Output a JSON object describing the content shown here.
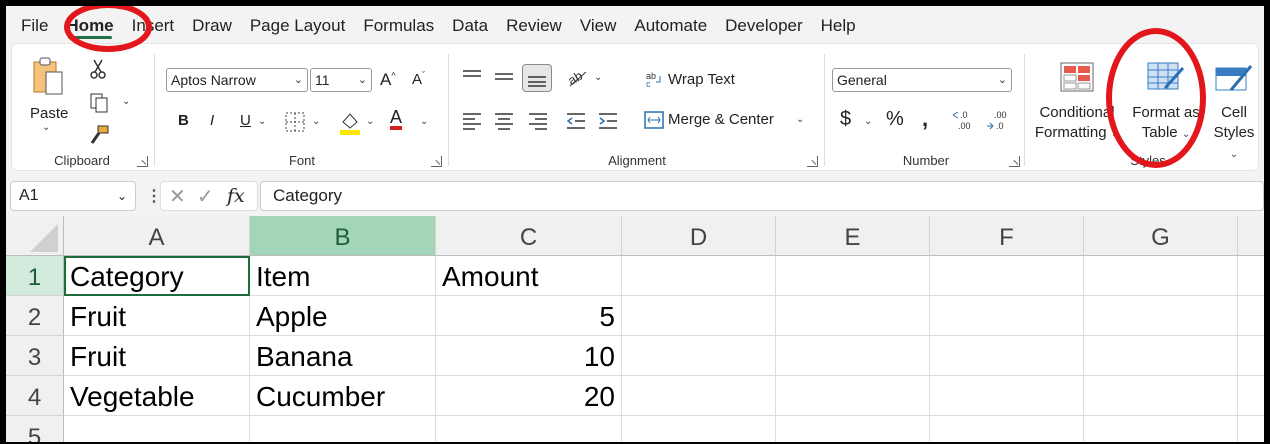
{
  "menu": {
    "tabs": [
      "File",
      "Home",
      "Insert",
      "Draw",
      "Page Layout",
      "Formulas",
      "Data",
      "Review",
      "View",
      "Automate",
      "Developer",
      "Help"
    ],
    "active": "Home"
  },
  "ribbon": {
    "clipboard": {
      "paste_label": "Paste",
      "group_label": "Clipboard"
    },
    "font": {
      "font_name": "Aptos Narrow",
      "font_size": "11",
      "bold": "B",
      "italic": "I",
      "underline": "U",
      "font_color_glyph": "A",
      "highlight_color": "#ffe600",
      "font_color": "#d61f1f",
      "group_label": "Font"
    },
    "alignment": {
      "wrap_text": "Wrap Text",
      "merge_center": "Merge & Center",
      "group_label": "Alignment"
    },
    "number": {
      "format": "General",
      "currency": "$",
      "percent": "%",
      "comma": ",",
      "group_label": "Number"
    },
    "styles": {
      "conditional_line1": "Conditional",
      "conditional_line2": "Formatting",
      "format_table_line1": "Format as",
      "format_table_line2": "Table",
      "cell_styles_line1": "Cell",
      "cell_styles_line2": "Styles",
      "group_label": "Styles"
    }
  },
  "formula_bar": {
    "name_box": "A1",
    "fx": "fx",
    "formula": "Category"
  },
  "sheet": {
    "columns": [
      "A",
      "B",
      "C",
      "D",
      "E",
      "F",
      "G"
    ],
    "rows": [
      "1",
      "2",
      "3",
      "4",
      "5"
    ],
    "cells": [
      [
        "Category",
        "Item",
        "Amount"
      ],
      [
        "Fruit",
        "Apple",
        "5"
      ],
      [
        "Fruit",
        "Banana",
        "10"
      ],
      [
        "Vegetable",
        "Cucumber",
        "20"
      ]
    ],
    "active_cell": "A1"
  },
  "colors": {
    "accent": "#1f7145",
    "annotation": "#e3161c",
    "selected_header": "#a3d6b8"
  }
}
